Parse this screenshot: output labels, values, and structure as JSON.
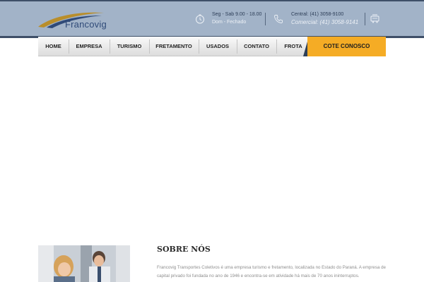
{
  "brand": {
    "name": "Francovig",
    "accent": "#b98e2b",
    "blue": "#2f4a78"
  },
  "header": {
    "hours_line1": "Seg - Sab 9.00 - 18.00",
    "hours_line2": "Dom - Fechado",
    "phone_line1": "Central: (41) 3058-9100",
    "phone_line2": "Comercial: (41) 3058-9141",
    "icons": [
      "clock-icon",
      "phone-icon",
      "cart-icon"
    ]
  },
  "nav": {
    "items": [
      "HOME",
      "EMPRESA",
      "TURISMO",
      "FRETAMENTO",
      "USADOS",
      "CONTATO",
      "FROTA"
    ],
    "cta": "COTE CONOSCO",
    "cta_color": "#f5ac25"
  },
  "about": {
    "title": "SOBRE NÓS",
    "text": "Francovig Transportes Coletivos é uma empresa turismo e fretamento, localizada no Estado do Paraná. A empresa de capital privado foi fundada no ano de 1946 e encontra-se em atividade há mais de 70 anos ininterruptos."
  }
}
